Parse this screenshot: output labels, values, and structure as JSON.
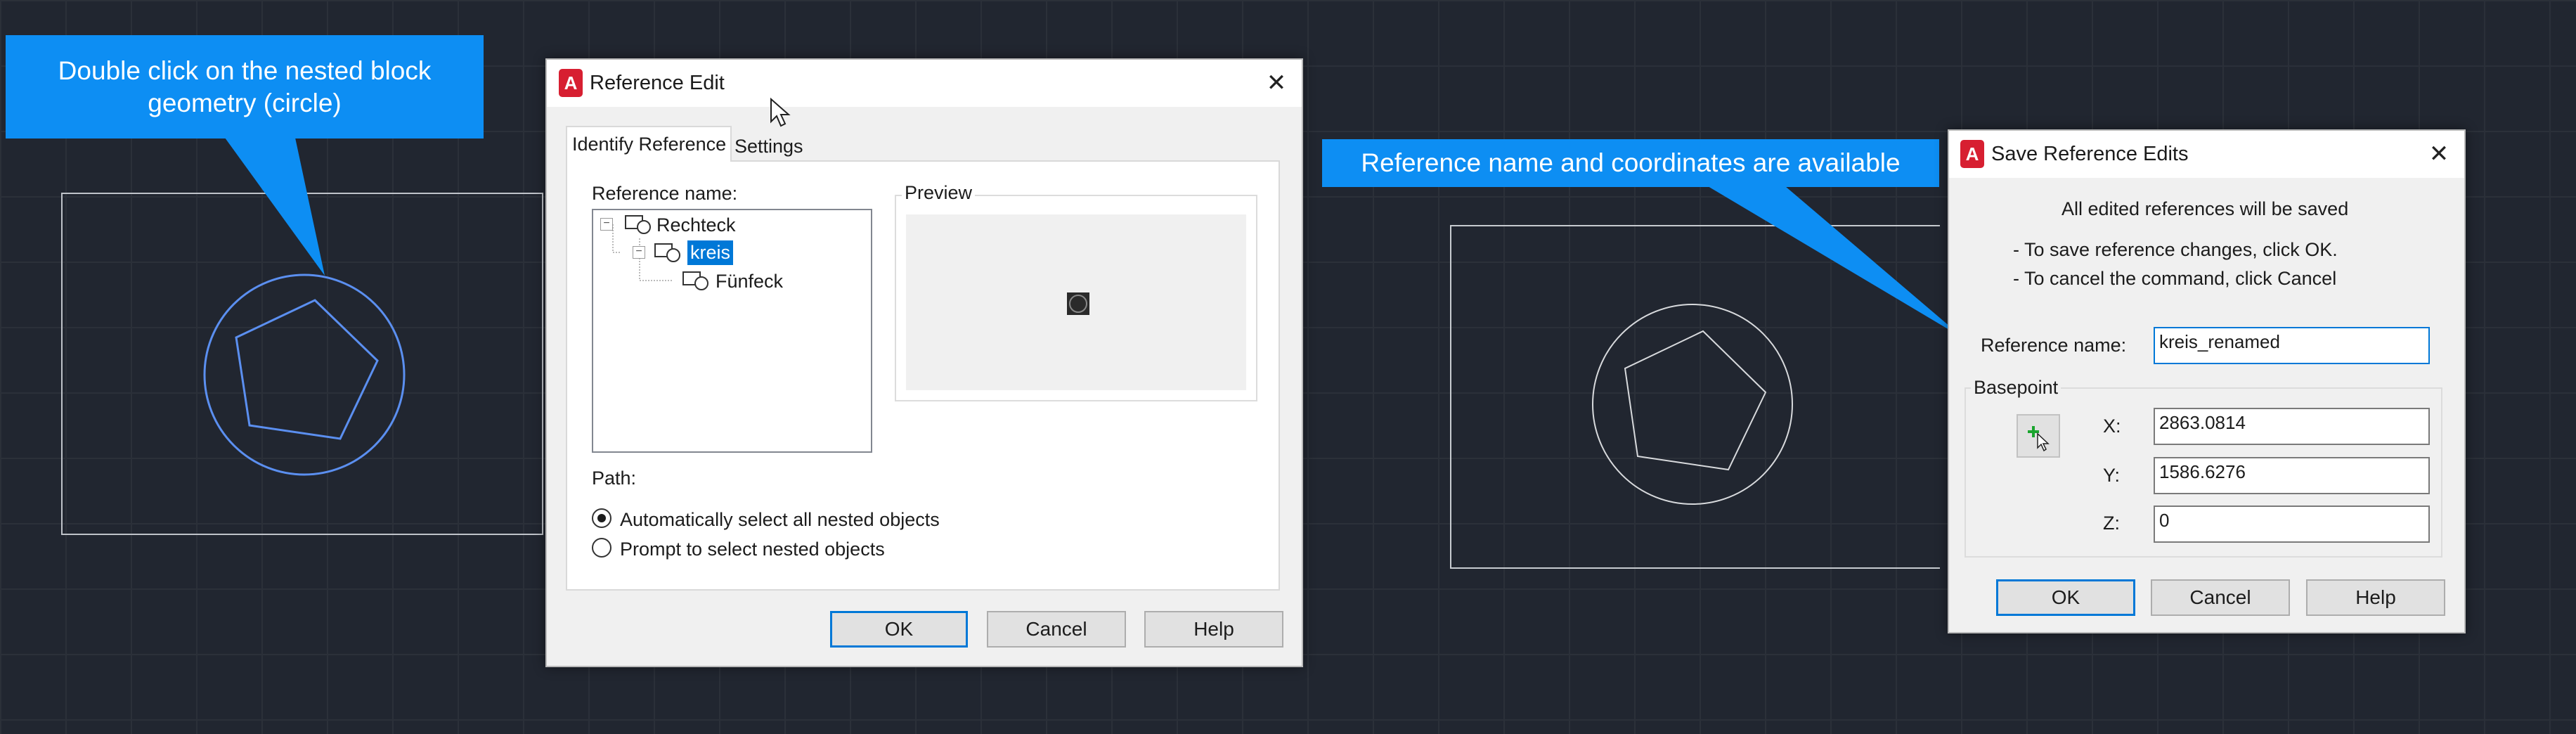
{
  "callouts": {
    "left": {
      "text": "Double click on the nested block geometry (circle)"
    },
    "middle": {
      "text": "Reference name and coordinates are available"
    }
  },
  "reference_edit": {
    "title": "Reference Edit",
    "app_icon": "A",
    "tabs": [
      "Identify Reference",
      "Settings"
    ],
    "reference_name_label": "Reference name:",
    "preview_label": "Preview",
    "tree": [
      {
        "label": "Rechteck",
        "level": 0
      },
      {
        "label": "kreis",
        "level": 1,
        "selected": true
      },
      {
        "label": "Fünfeck",
        "level": 2
      }
    ],
    "path_label": "Path:",
    "options": [
      {
        "label": "Automatically select all nested objects",
        "checked": true
      },
      {
        "label": "Prompt to select nested objects",
        "checked": false
      }
    ],
    "buttons": {
      "ok": "OK",
      "cancel": "Cancel",
      "help": "Help"
    }
  },
  "save_reference_edits": {
    "title": "Save Reference Edits",
    "app_icon": "A",
    "message": "All edited references will be saved",
    "hint_ok": "- To save reference changes, click OK.",
    "hint_cancel": "- To cancel the command, click Cancel",
    "reference_name_label": "Reference name:",
    "reference_name_value": "kreis_renamed",
    "basepoint_label": "Basepoint",
    "x_label": "X:",
    "x_value": "2863.0814",
    "y_label": "Y:",
    "y_value": "1586.6276",
    "z_label": "Z:",
    "z_value": "0",
    "pick_point_icon": "pick-point-icon",
    "buttons": {
      "ok": "OK",
      "cancel": "Cancel",
      "help": "Help"
    }
  },
  "colors": {
    "background": "#212630",
    "accent": "#0d8ef3",
    "selection": "#0078d7",
    "autocad_red": "#d71f31",
    "highlight_geometry": "#5b8ff0"
  }
}
